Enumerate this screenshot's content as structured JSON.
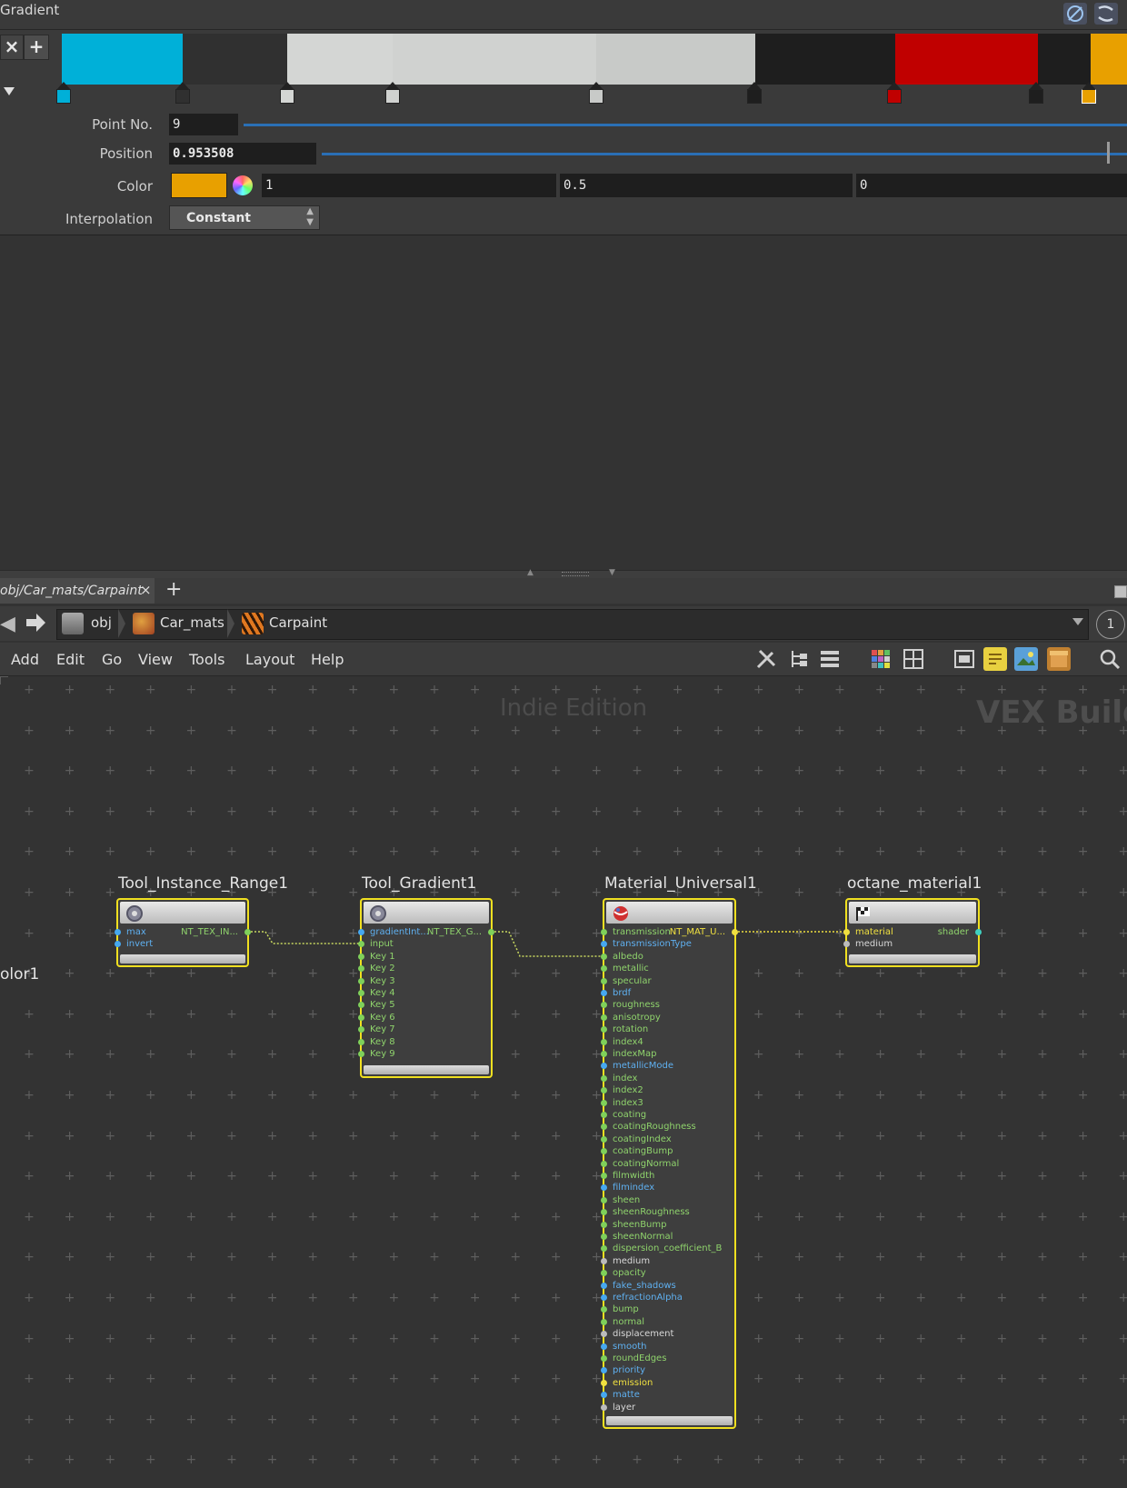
{
  "gradient_panel": {
    "title": "Gradient",
    "remove_btn": "×",
    "add_btn": "+",
    "ramp_colors": [
      "#00b0d8",
      "#303030",
      "#d4d6d4",
      "#d0d2d0",
      "#c8cac8",
      "#1e1e1e",
      "#c00000",
      "#1e1e1e",
      "#e8a000"
    ],
    "keys": [
      {
        "color": "#00b0d8"
      },
      {
        "color": "#303030"
      },
      {
        "color": "#d4d6d4"
      },
      {
        "color": "#d0d2d0"
      },
      {
        "color": "#c8cac8"
      },
      {
        "color": "#1e1e1e"
      },
      {
        "color": "#c00000"
      },
      {
        "color": "#1e1e1e"
      },
      {
        "color": "#e8a000"
      }
    ],
    "point_no_label": "Point No.",
    "point_no_value": "9",
    "position_label": "Position",
    "position_value": "0.953508",
    "color_label": "Color",
    "color_swatch": "#e8a000",
    "color_r": "1",
    "color_g": "0.5",
    "color_b": "0",
    "interp_label": "Interpolation",
    "interp_value": "Constant"
  },
  "network": {
    "tab_label": "obj/Car_mats/Carpaint",
    "tab_close": "×",
    "tab_add": "+",
    "crumbs": [
      "obj",
      "Car_mats",
      "Carpaint"
    ],
    "crumb_count": "1",
    "menus": [
      "Add",
      "Edit",
      "Go",
      "View",
      "Tools",
      "Layout",
      "Help"
    ],
    "watermark": "Indie Edition",
    "context_label": "VEX Builde",
    "left_cut_label": "olor1"
  },
  "nodes": {
    "range": {
      "title": "Tool_Instance_Range1",
      "inputs": [
        "max",
        "invert"
      ],
      "output": "NT_TEX_IN..."
    },
    "gradient": {
      "title": "Tool_Gradient1",
      "inputs": [
        "gradientInt...",
        "input",
        "Key 1",
        "Key 2",
        "Key 3",
        "Key 4",
        "Key 5",
        "Key 6",
        "Key 7",
        "Key 8",
        "Key 9"
      ],
      "output": "NT_TEX_G..."
    },
    "material": {
      "title": "Material_Universal1",
      "inputs": [
        "transmission",
        "transmissionType",
        "albedo",
        "metallic",
        "specular",
        "brdf",
        "roughness",
        "anisotropy",
        "rotation",
        "index4",
        "indexMap",
        "metallicMode",
        "index",
        "index2",
        "index3",
        "coating",
        "coatingRoughness",
        "coatingIndex",
        "coatingBump",
        "coatingNormal",
        "filmwidth",
        "filmindex",
        "sheen",
        "sheenRoughness",
        "sheenBump",
        "sheenNormal",
        "dispersion_coefficient_B",
        "medium",
        "opacity",
        "fake_shadows",
        "refractionAlpha",
        "bump",
        "normal",
        "displacement",
        "smooth",
        "roundEdges",
        "priority",
        "emission",
        "matte",
        "layer"
      ],
      "output": "NT_MAT_U..."
    },
    "octane": {
      "title": "octane_material1",
      "inputs": [
        "material",
        "medium"
      ],
      "output": "shader"
    }
  }
}
